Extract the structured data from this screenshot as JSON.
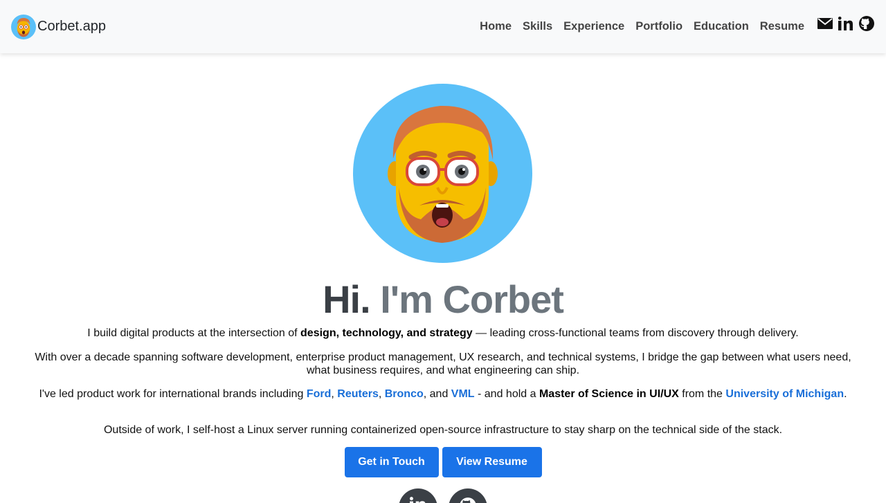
{
  "brand": {
    "name": "Corbet.app",
    "avatar_icon": "memoji-avatar-icon"
  },
  "nav": {
    "links": [
      "Home",
      "Skills",
      "Experience",
      "Portfolio",
      "Education",
      "Resume"
    ],
    "social": [
      "mail-icon",
      "linkedin-icon",
      "github-icon"
    ]
  },
  "hero": {
    "headline_hi": "Hi.",
    "headline_name": "I'm Corbet",
    "p1_a": "I build digital products at the intersection of ",
    "p1_b": "design, technology, and strategy",
    "p1_c": " — leading cross-functional teams from discovery through delivery.",
    "p2": "With over a decade spanning software development, enterprise product management, UX research, and technical systems, I bridge the gap between what users need, what business requires, and what engineering can ship.",
    "p3_a": "I've led product work for international brands including ",
    "p3_ford": "Ford",
    "p3_sep1": ", ",
    "p3_reuters": "Reuters",
    "p3_sep2": ", ",
    "p3_bronco": "Bronco",
    "p3_sep3": ", and ",
    "p3_vml": "VML",
    "p3_b": " - and hold a ",
    "p3_degree": "Master of Science in UI/UX",
    "p3_c": " from the ",
    "p3_univ": "University of Michigan",
    "p3_d": ".",
    "p4": "Outside of work, I self-host a Linux server running containerized open-source infrastructure to stay sharp on the technical side of the stack."
  },
  "buttons": {
    "contact": "Get in Touch",
    "resume": "View Resume"
  },
  "colors": {
    "accent": "#1a73e8",
    "link": "#1a6fd8",
    "avatar_bg": "#5bc0f8",
    "navbar_bg": "#f8f9fa"
  }
}
